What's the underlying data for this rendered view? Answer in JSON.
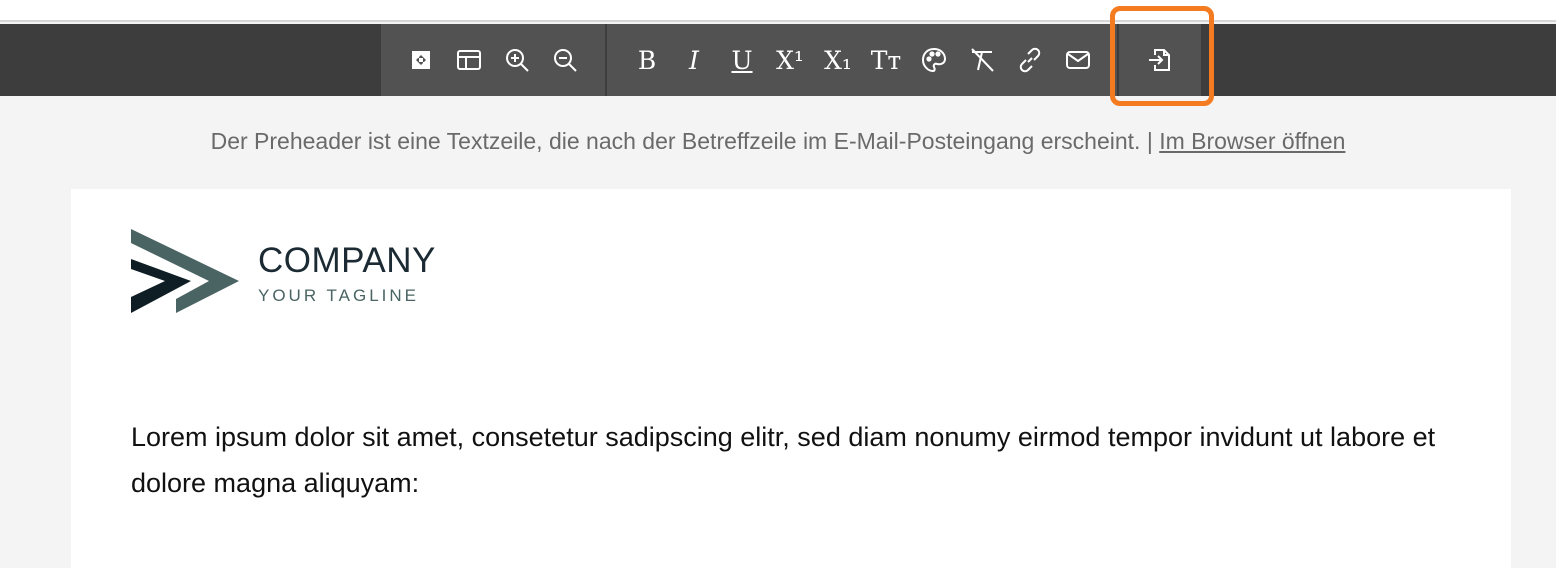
{
  "toolbar": {
    "group_view": [
      {
        "name": "move-icon"
      },
      {
        "name": "layout-icon"
      },
      {
        "name": "zoom-in-icon"
      },
      {
        "name": "zoom-out-icon"
      }
    ],
    "group_format": [
      {
        "name": "bold-icon",
        "glyph": "B"
      },
      {
        "name": "italic-icon",
        "glyph": "I"
      },
      {
        "name": "underline-icon",
        "glyph": "U"
      },
      {
        "name": "superscript-icon",
        "glyph": "X¹"
      },
      {
        "name": "subscript-icon",
        "glyph": "X₁"
      },
      {
        "name": "font-size-icon",
        "glyph": "Tт"
      },
      {
        "name": "palette-icon"
      },
      {
        "name": "clear-format-icon"
      },
      {
        "name": "link-icon"
      },
      {
        "name": "email-icon"
      }
    ],
    "group_insert": [
      {
        "name": "import-icon"
      }
    ],
    "highlight_color": "#f47b20"
  },
  "preheader": {
    "text": "Der Preheader ist eine Textzeile, die nach der Betreffzeile im E-Mail-Posteingang erscheint. | ",
    "link": "Im Browser öffnen"
  },
  "logo": {
    "name": "COMPANY",
    "tagline": "YOUR TAGLINE",
    "colors": {
      "dark": "#0f1e24",
      "accent": "#4a6363"
    }
  },
  "body": {
    "text": "Lorem ipsum dolor sit amet, consetetur sadipscing elitr, sed diam nonumy eirmod tempor invidunt ut labore et dolore magna aliquyam:"
  }
}
